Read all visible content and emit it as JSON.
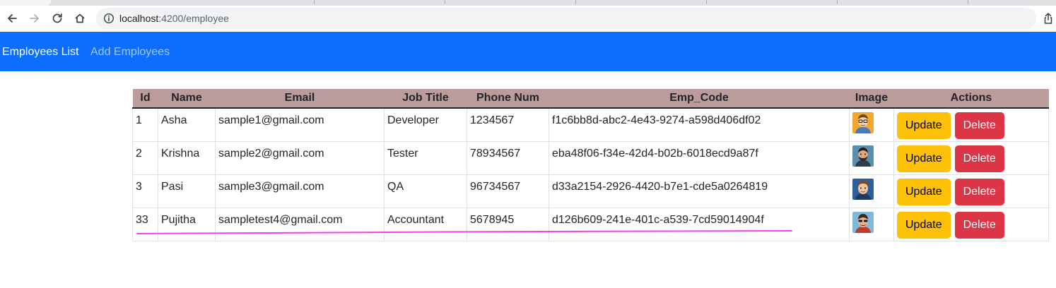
{
  "browser": {
    "url_host": "localhost",
    "url_path": ":4200/employee",
    "icons": [
      "back-arrow-icon",
      "forward-arrow-icon",
      "reload-icon",
      "home-icon",
      "site-info-icon",
      "share-icon"
    ]
  },
  "navbar": {
    "links": [
      {
        "label": "Employees List",
        "active": true
      },
      {
        "label": "Add Employees",
        "active": false
      }
    ],
    "color": "#0d6efd"
  },
  "table": {
    "header_color": "#bc9b9b",
    "columns": [
      "Id",
      "Name",
      "Email",
      "Job Title",
      "Phone Num",
      "Emp_Code",
      "Image",
      "Actions"
    ],
    "rows": [
      {
        "id": "1",
        "name": "Asha",
        "email": "sample1@gmail.com",
        "job_title": "Developer",
        "phone": "1234567",
        "emp_code": "f1c6bb8d-abc2-4e43-9274-a598d406df02",
        "image": "avatar-glasses-icon"
      },
      {
        "id": "2",
        "name": "Krishna",
        "email": "sample2@gmail.com",
        "job_title": "Tester",
        "phone": "78934567",
        "emp_code": "eba48f06-f34e-42d4-b02b-6018ecd9a87f",
        "image": "avatar-beard-icon"
      },
      {
        "id": "3",
        "name": "Pasi",
        "email": "sample3@gmail.com",
        "job_title": "QA",
        "phone": "96734567",
        "emp_code": "d33a2154-2926-4420-b7e1-cde5a0264819",
        "image": "avatar-young-man-icon"
      },
      {
        "id": "33",
        "name": "Pujitha",
        "email": "sampletest4@gmail.com",
        "job_title": "Accountant",
        "phone": "5678945",
        "emp_code": "d126b609-241e-401c-a539-7cd59014904f",
        "image": "avatar-sunglasses-icon"
      }
    ],
    "actions": {
      "update_label": "Update",
      "delete_label": "Delete",
      "update_color": "#ffc107",
      "delete_color": "#dc3545"
    }
  },
  "annotation": {
    "color": "#ee44ee",
    "icon": "highlight-underline"
  }
}
